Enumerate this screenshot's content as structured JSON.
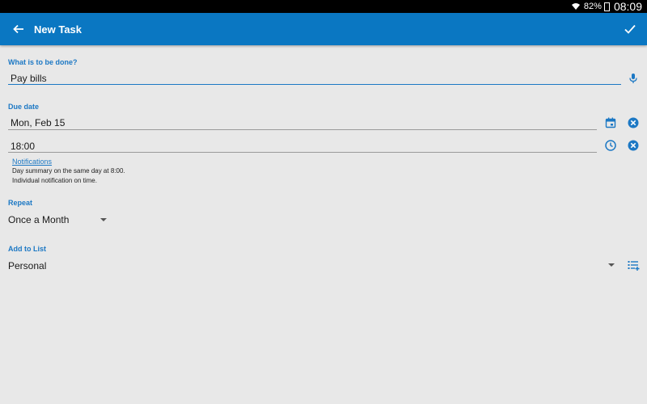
{
  "status_bar": {
    "battery": "82%",
    "time": "08:09"
  },
  "app_bar": {
    "title": "New Task",
    "back_icon": "arrow-left-icon",
    "confirm_icon": "check-icon"
  },
  "task": {
    "label": "What is to be done?",
    "value": "Pay bills",
    "mic_icon": "microphone-icon"
  },
  "due": {
    "label": "Due date",
    "date": "Mon, Feb 15",
    "time": "18:00",
    "calendar_icon": "calendar-icon",
    "clock_icon": "clock-icon",
    "clear_icon": "clear-icon"
  },
  "notifications": {
    "link": "Notifications",
    "line1": "Day summary on the same day at 8:00.",
    "line2": "Individual notification on time."
  },
  "repeat": {
    "label": "Repeat",
    "value": "Once a Month"
  },
  "list": {
    "label": "Add to List",
    "value": "Personal",
    "manage_icon": "list-add-icon"
  },
  "colors": {
    "accent": "#0a77c2",
    "background": "#e8e8e8"
  }
}
